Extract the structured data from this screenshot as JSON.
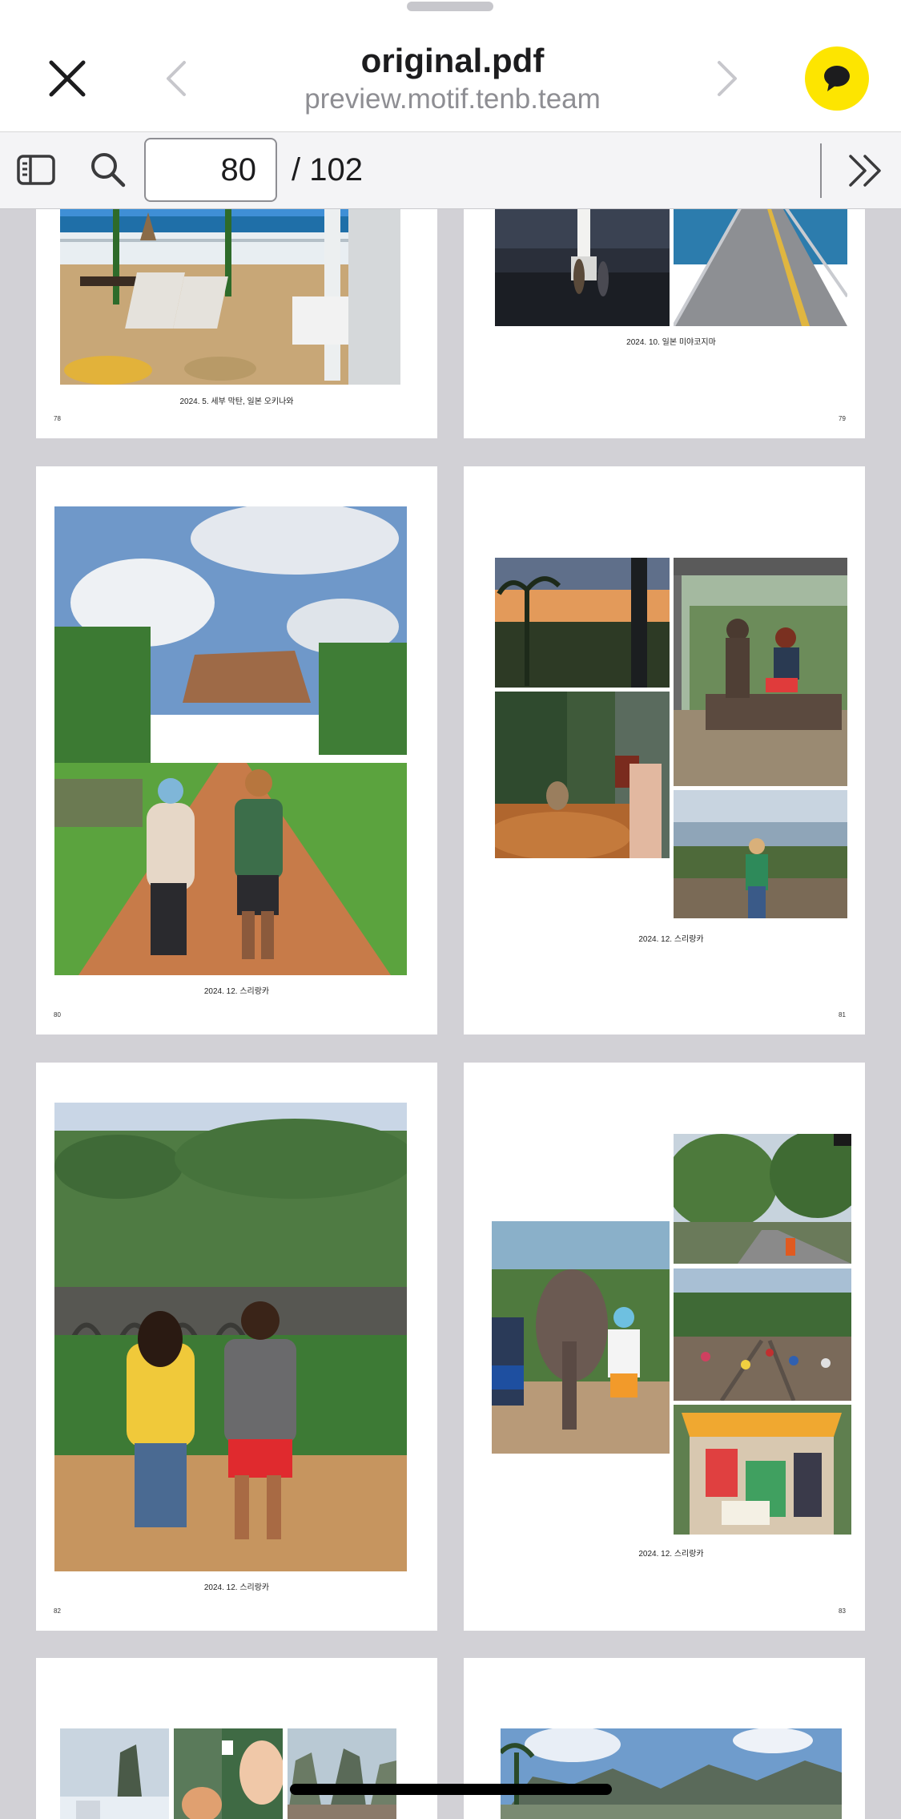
{
  "header": {
    "title": "original.pdf",
    "subtitle": "preview.motif.tenb.team"
  },
  "toolbar": {
    "current_page": "80",
    "total_pages": "/ 102"
  },
  "pages": [
    {
      "caption": "2024. 5. 세부 막탄, 일본 오키나와",
      "number": "78"
    },
    {
      "caption": "2024. 10. 일본 미야코지마",
      "number": "79"
    },
    {
      "caption": "2024. 12. 스리랑카",
      "number": "80"
    },
    {
      "caption": "2024. 12. 스리랑카",
      "number": "81"
    },
    {
      "caption": "2024. 12. 스리랑카",
      "number": "82"
    },
    {
      "caption": "2024. 12. 스리랑카",
      "number": "83"
    }
  ],
  "colors": {
    "accent": "#fde500",
    "viewer_background": "#d2d1d6"
  }
}
